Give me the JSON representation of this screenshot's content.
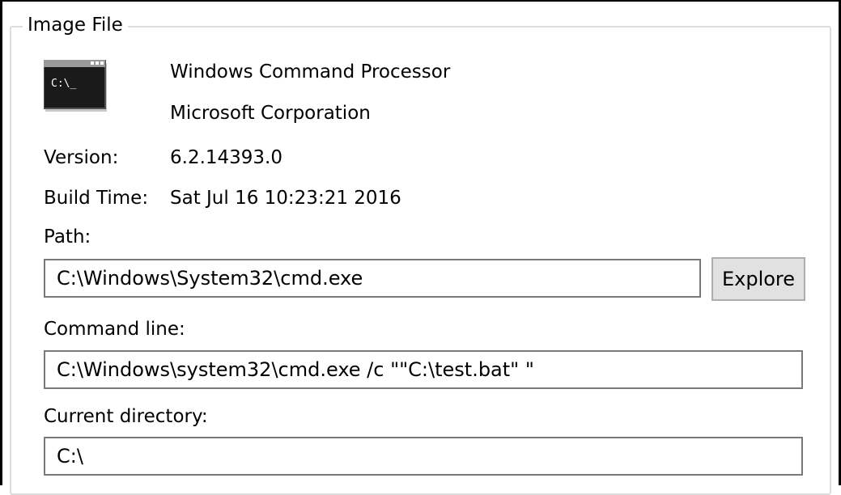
{
  "group": {
    "title": "Image File"
  },
  "app": {
    "icon": "console-icon",
    "icon_text": "C:\\_",
    "description": "Windows Command Processor",
    "company": "Microsoft Corporation"
  },
  "version": {
    "label": "Version:",
    "value": "6.2.14393.0"
  },
  "build_time": {
    "label": "Build Time:",
    "value": "Sat Jul 16 10:23:21 2016"
  },
  "path": {
    "label": "Path:",
    "value": "C:\\Windows\\System32\\cmd.exe",
    "explore_label": "Explore"
  },
  "command_line": {
    "label": "Command line:",
    "value": "C:\\Windows\\system32\\cmd.exe /c \"\"C:\\test.bat\" \""
  },
  "current_directory": {
    "label": "Current directory:",
    "value": "C:\\"
  },
  "colors": {
    "window_border": "#000000",
    "group_border": "#dcdcdc",
    "field_border": "#7a7a7a",
    "button_bg": "#e1e1e1"
  }
}
